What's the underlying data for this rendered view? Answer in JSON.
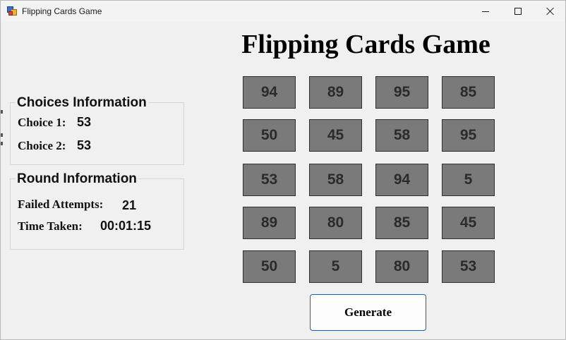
{
  "window": {
    "title": "Flipping Cards Game"
  },
  "game_title": "Flipping Cards Game",
  "choices": {
    "title": "Choices Information",
    "choice1_label": "Choice 1:",
    "choice1_value": "53",
    "choice2_label": "Choice 2:",
    "choice2_value": "53"
  },
  "round": {
    "title": "Round Information",
    "failed_label": "Failed Attempts:",
    "failed_value": "21",
    "time_label": "Time Taken:",
    "time_value": "00:01:15"
  },
  "cards": [
    "94",
    "89",
    "95",
    "85",
    "50",
    "45",
    "58",
    "95",
    "53",
    "58",
    "94",
    "5",
    "89",
    "80",
    "85",
    "45",
    "50",
    "5",
    "80",
    "53"
  ],
  "generate_label": "Generate",
  "colors": {
    "card_face": "#7a7a7a",
    "card_text": "#2b2b2b",
    "button_border": "#0a64c2",
    "background": "#f0f0f0"
  }
}
